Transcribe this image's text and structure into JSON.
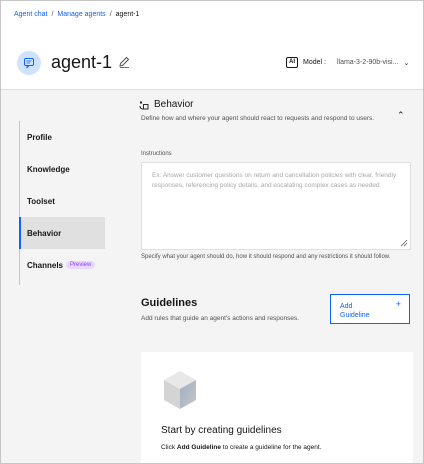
{
  "breadcrumb": {
    "items": [
      "Agent chat",
      "Manage agents"
    ],
    "separator": "/",
    "current": "agent-1"
  },
  "header": {
    "agent_name": "agent-1",
    "ai_badge": "AI",
    "model_label": "Model :",
    "model_value": "llama-3-2-90b-visi..."
  },
  "nav": {
    "items": [
      {
        "label": "Profile"
      },
      {
        "label": "Knowledge"
      },
      {
        "label": "Toolset"
      },
      {
        "label": "Behavior",
        "active": true
      },
      {
        "label": "Channels",
        "tag": "Preview"
      }
    ]
  },
  "behavior": {
    "title": "Behavior",
    "description": "Define how and where your agent should react to requests and respond to users.",
    "instructions_label": "Instructions",
    "instructions_placeholder": "Ex: Answer customer questions on return and cancellation policies with clear, friendly responses, referencing policy details, and escalating complex cases as needed",
    "helper": "Specify what your agent should do, how it should respond and any restrictions it should follow."
  },
  "guidelines": {
    "title": "Guidelines",
    "description": "Add rules that guide an agent's actions and responses.",
    "add_button": "Add Guideline",
    "add_icon": "+",
    "empty_title": "Start by creating guidelines",
    "empty_prefix": "Click",
    "empty_emphasis": "Add Guideline",
    "empty_suffix": "to create a guideline for the agent."
  },
  "colors": {
    "accent": "#0f62fe",
    "preview_tag": "#8a3ffc",
    "avatar_bg": "#d0e2ff"
  },
  "icons": [
    "chat-icon",
    "edit-icon",
    "chevron-down-icon",
    "behavior-icon",
    "chevron-up-icon",
    "plus-icon",
    "cube-icon",
    "resize-handle-icon"
  ]
}
